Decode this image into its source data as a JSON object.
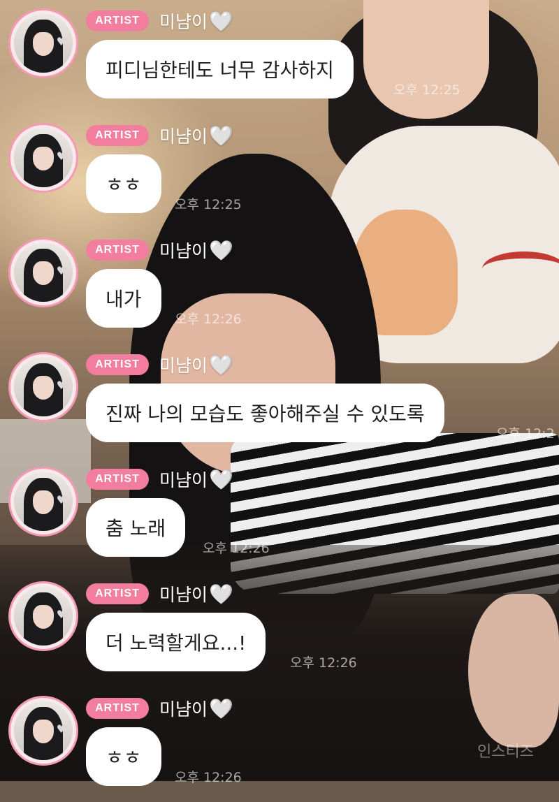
{
  "badge_label": "ARTIST",
  "sender_name": "미냠이",
  "heart_glyph": "🤍",
  "messages": [
    {
      "text": "피디님한테도 너무 감사하지",
      "time": "오후 12:25"
    },
    {
      "text": "ㅎㅎ",
      "time": "오후 12:25"
    },
    {
      "text": "내가",
      "time": "오후 12:26"
    },
    {
      "text": "진짜 나의 모습도 좋아해주실 수 있도록",
      "time": "오후 12:2"
    },
    {
      "text": "춤 노래",
      "time": "오후 12:26"
    },
    {
      "text": "더 노력할게요...!",
      "time": "오후 12:26"
    },
    {
      "text": "ㅎㅎ",
      "time": "오후 12:26"
    }
  ],
  "watermark": "인스티즈",
  "colors": {
    "badge": "#f37d9e",
    "avatar_ring": "#f49ab2",
    "bubble": "#ffffff"
  },
  "icons": {
    "heart": "white-heart-icon"
  }
}
